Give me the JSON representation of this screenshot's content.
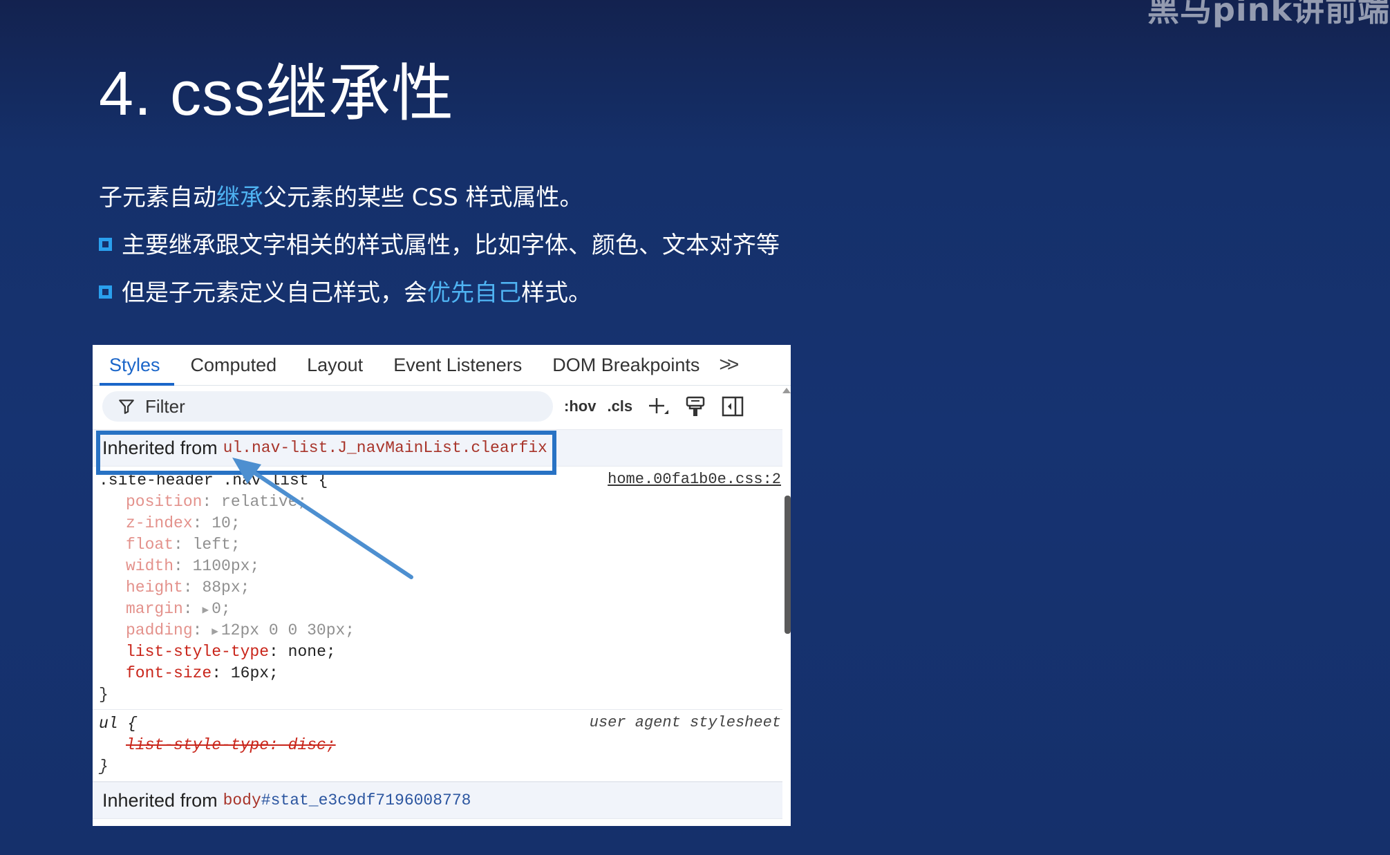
{
  "watermark": "黑马pink讲前端",
  "slide": {
    "title": "4. css继承性",
    "line1_pre": "子元素自动",
    "line1_hl": "继承",
    "line1_post": "父元素的某些 CSS 样式属性。",
    "bullet1": "主要继承跟文字相关的样式属性，比如字体、颜色、文本对齐等",
    "bullet2_pre": "但是子元素定义自己样式，会",
    "bullet2_hl": "优先自己",
    "bullet2_post": "样式。"
  },
  "colors": {
    "accent": "#4fb3f2",
    "bullet": "#2aa0ee",
    "highlight_box": "#2872c4",
    "devtools_active": "#1b66c9"
  },
  "devtools": {
    "tabs": [
      "Styles",
      "Computed",
      "Layout",
      "Event Listeners",
      "DOM Breakpoints"
    ],
    "more": ">>",
    "filter_placeholder": "Filter",
    "hov": ":hov",
    "cls": ".cls",
    "icons": [
      "filter-icon",
      "plus-icon",
      "paint-brush-icon",
      "sidebar-toggle-icon"
    ],
    "inherited1": {
      "label": "Inherited from",
      "selector": "ul.nav-list.J_navMainList.clearfix"
    },
    "rule1": {
      "selector": ".site-header .nav-list {",
      "source": "home.00fa1b0e.css:2",
      "declarations": [
        {
          "prop": "position",
          "value": "relative;",
          "inherited": false
        },
        {
          "prop": "z-index",
          "value": "10;",
          "inherited": false
        },
        {
          "prop": "float",
          "value": "left;",
          "inherited": false
        },
        {
          "prop": "width",
          "value": "1100px;",
          "inherited": false
        },
        {
          "prop": "height",
          "value": "88px;",
          "inherited": false
        },
        {
          "prop": "margin",
          "value": "0;",
          "inherited": false,
          "expandable": true
        },
        {
          "prop": "padding",
          "value": "12px 0 0 30px;",
          "inherited": false,
          "expandable": true
        },
        {
          "prop": "list-style-type",
          "value": "none;",
          "inherited": true
        },
        {
          "prop": "font-size",
          "value": "16px;",
          "inherited": true
        }
      ],
      "close": "}"
    },
    "rule2": {
      "selector": "ul {",
      "source": "user agent stylesheet",
      "declaration": "list-style-type: disc;",
      "close": "}"
    },
    "inherited2": {
      "label": "Inherited from",
      "tag": "body",
      "id": "#stat_e3c9df7196008778"
    }
  }
}
